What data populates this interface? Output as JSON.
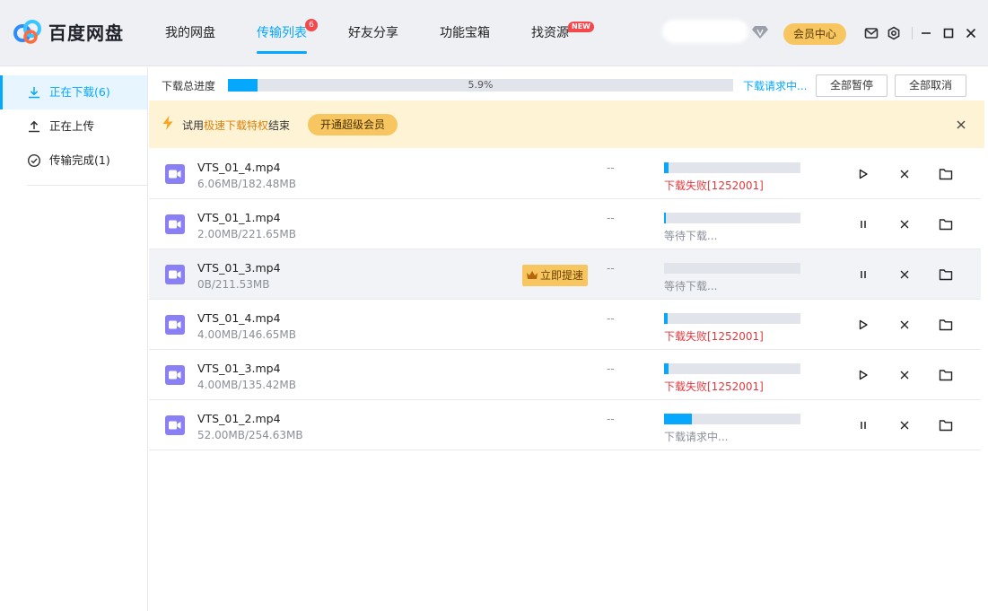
{
  "app": {
    "name": "百度网盘"
  },
  "nav": {
    "items": [
      {
        "label": "我的网盘"
      },
      {
        "label": "传输列表",
        "badge": "6"
      },
      {
        "label": "好友分享"
      },
      {
        "label": "功能宝箱"
      },
      {
        "label": "找资源",
        "badge": "NEW"
      }
    ]
  },
  "header": {
    "vip_label": "会员中心"
  },
  "sidebar": {
    "items": [
      {
        "label": "正在下载(6)"
      },
      {
        "label": "正在上传"
      },
      {
        "label": "传输完成(1)"
      }
    ]
  },
  "summary": {
    "label": "下载总进度",
    "percent": "5.9%",
    "progress": 0.059,
    "status": "下载请求中...",
    "pause_all": "全部暂停",
    "cancel_all": "全部取消"
  },
  "promo": {
    "prefix": "试用",
    "highlight": "极速下载特权",
    "suffix": "结束",
    "button": "开通超级会员"
  },
  "boost_label": "立即提速",
  "colors": {
    "accent": "#06a7ff",
    "error": "#e0383e",
    "gold": "#f7c660"
  },
  "files": [
    {
      "name": "VTS_01_4.mp4",
      "size": "6.06MB/182.48MB",
      "speed": "--",
      "progress": 0.033,
      "status": "下载失败[1252001]",
      "status_type": "error",
      "action": "play"
    },
    {
      "name": "VTS_01_1.mp4",
      "size": "2.00MB/221.65MB",
      "speed": "--",
      "progress": 0.009,
      "status": "等待下载...",
      "status_type": "normal",
      "action": "pause"
    },
    {
      "name": "VTS_01_3.mp4",
      "size": "0B/211.53MB",
      "speed": "--",
      "progress": 0,
      "status": "等待下载...",
      "status_type": "normal",
      "action": "pause"
    },
    {
      "name": "VTS_01_4.mp4",
      "size": "4.00MB/146.65MB",
      "speed": "--",
      "progress": 0.027,
      "status": "下载失败[1252001]",
      "status_type": "error",
      "action": "play"
    },
    {
      "name": "VTS_01_3.mp4",
      "size": "4.00MB/135.42MB",
      "speed": "--",
      "progress": 0.03,
      "status": "下载失败[1252001]",
      "status_type": "error",
      "action": "play"
    },
    {
      "name": "VTS_01_2.mp4",
      "size": "52.00MB/254.63MB",
      "speed": "--",
      "progress": 0.204,
      "status": "下载请求中...",
      "status_type": "normal",
      "action": "pause"
    }
  ]
}
